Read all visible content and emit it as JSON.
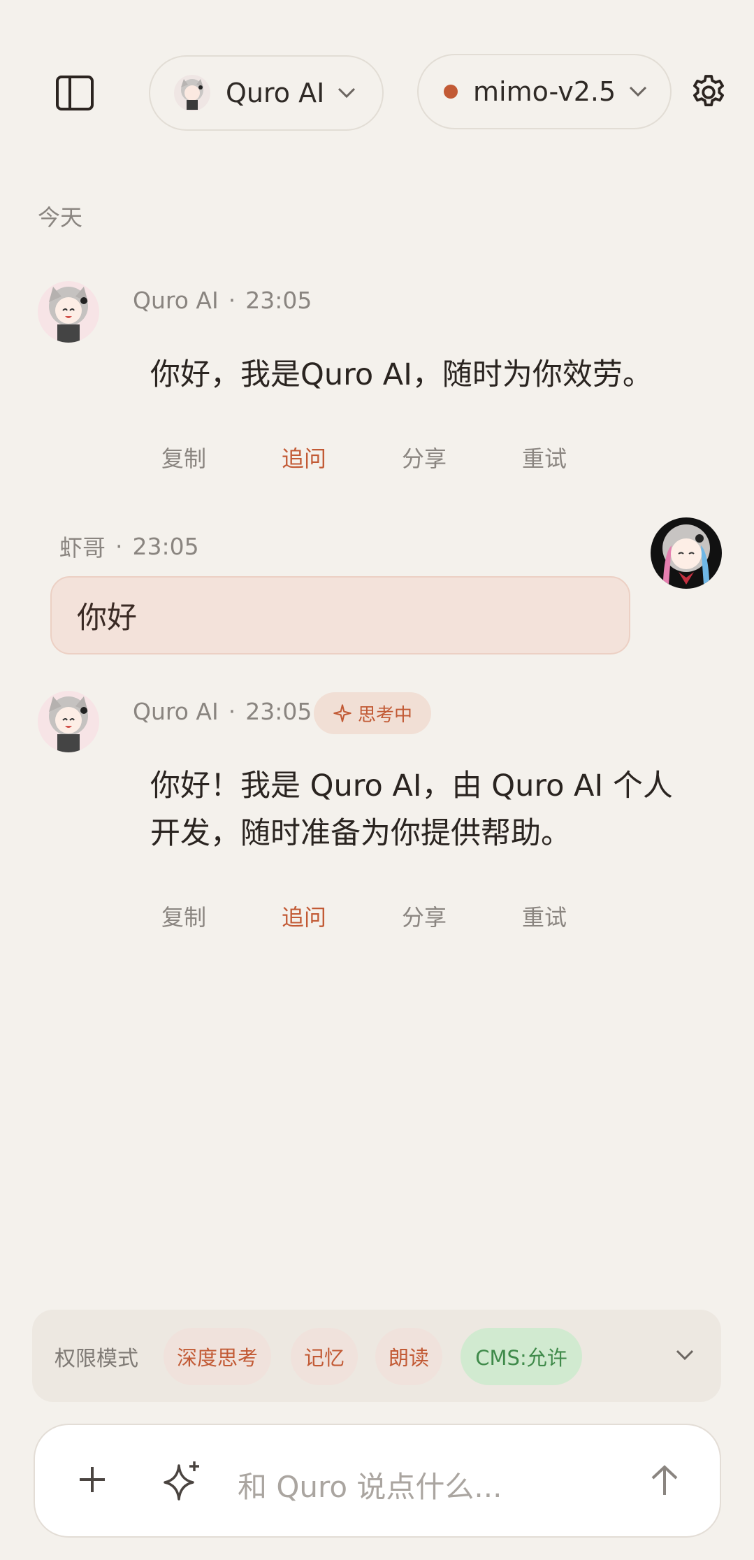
{
  "header": {
    "sidebar_icon": "sidebar-toggle-icon",
    "agent_name": "Quro AI",
    "model_name": "mimo-v2.5",
    "model_status_color": "#c25a35",
    "settings_icon": "gear-icon"
  },
  "date_divider": "今天",
  "messages": [
    {
      "sender": "Quro AI",
      "separator": "·",
      "time": "23:05",
      "text": "你好，我是Quro AI，随时为你效劳。",
      "actions": [
        "复制",
        "追问",
        "分享",
        "重试"
      ]
    },
    {
      "sender": "虾哥",
      "separator": "·",
      "time": "23:05",
      "text": "你好"
    },
    {
      "sender": "Quro AI",
      "separator": "·",
      "time": "23:05",
      "badge": "思考中",
      "text_line1": "你好！我是 Quro AI，由 Quro AI 个人",
      "text_line2": "开发，随时准备为你提供帮助。",
      "actions": [
        "复制",
        "追问",
        "分享",
        "重试"
      ]
    }
  ],
  "toolbar": {
    "label": "权限模式",
    "chips": [
      "深度思考",
      "记忆",
      "朗读",
      "CMS:允许"
    ]
  },
  "composer": {
    "placeholder": "和 Quro 说点什么..."
  },
  "colors": {
    "accent": "#c25a35",
    "background": "#f4f1ec",
    "user_bubble": "#f3e2da",
    "green_chip": "#d1ead0"
  }
}
